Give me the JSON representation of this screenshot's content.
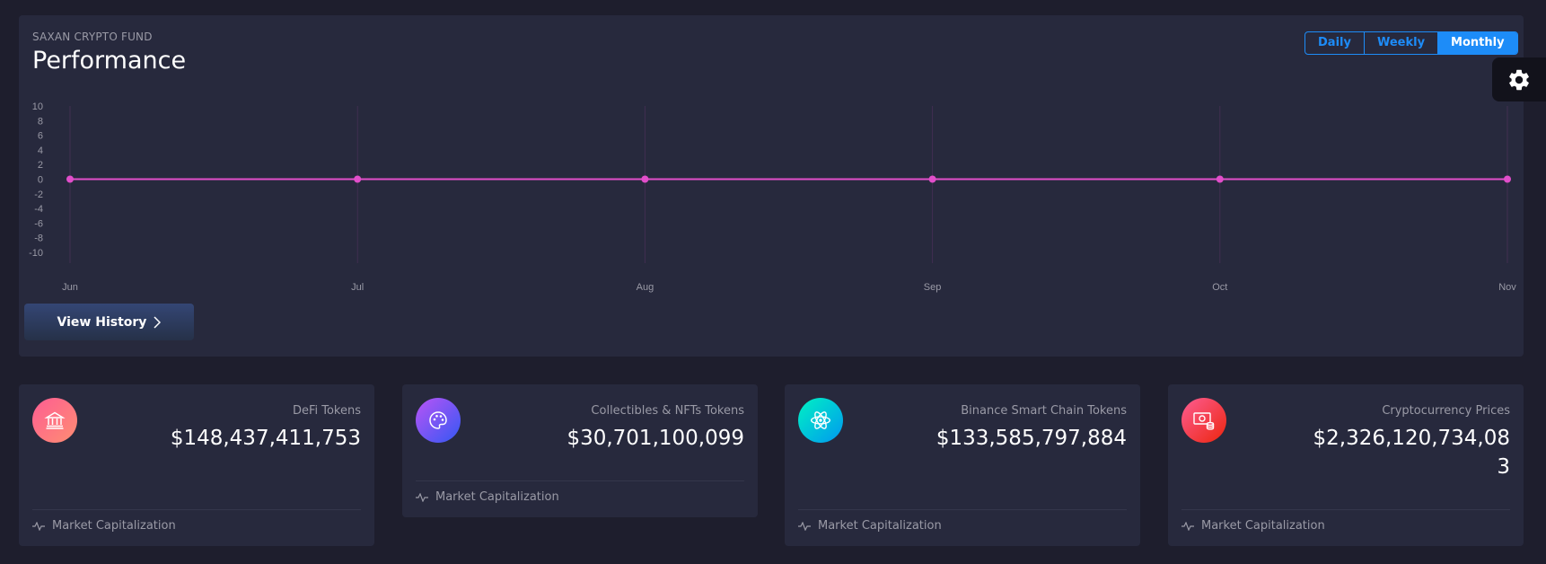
{
  "performance": {
    "kicker": "SAXAN CRYPTO FUND",
    "title": "Performance",
    "period_buttons": [
      "Daily",
      "Weekly",
      "Monthly"
    ],
    "active_period": "Monthly",
    "view_history_label": "View History",
    "line_color": "#e14eca"
  },
  "chart_data": {
    "type": "line",
    "categories": [
      "Jun",
      "Jul",
      "Aug",
      "Sep",
      "Oct",
      "Nov"
    ],
    "series": [
      {
        "values": [
          0,
          0,
          0,
          0,
          0,
          0
        ]
      }
    ],
    "yticks": [
      10,
      8,
      6,
      4,
      2,
      0,
      -2,
      -4,
      -6,
      -8,
      -10
    ],
    "ylim": [
      -10,
      10
    ],
    "grid": "vertical",
    "legend": "none"
  },
  "stats": [
    {
      "label": "DeFi Tokens",
      "value": "$148,437,411,753",
      "footer": "Market Capitalization",
      "icon": "bank-icon",
      "gradient": [
        "#fd5d93",
        "#ff8d72"
      ]
    },
    {
      "label": "Collectibles & NFTs Tokens",
      "value": "$30,701,100,099",
      "footer": "Market Capitalization",
      "icon": "palette-icon",
      "gradient": [
        "#ba54f5",
        "#3358f4"
      ]
    },
    {
      "label": "Binance Smart Chain Tokens",
      "value": "$133,585,797,884",
      "footer": "Market Capitalization",
      "icon": "atom-icon",
      "gradient": [
        "#00f2c3",
        "#0098f0"
      ]
    },
    {
      "label": "Cryptocurrency Prices",
      "value": "$2,326,120,734,083",
      "footer": "Market Capitalization",
      "icon": "money-icon",
      "gradient": [
        "#fd5d93",
        "#ec250d"
      ]
    }
  ]
}
